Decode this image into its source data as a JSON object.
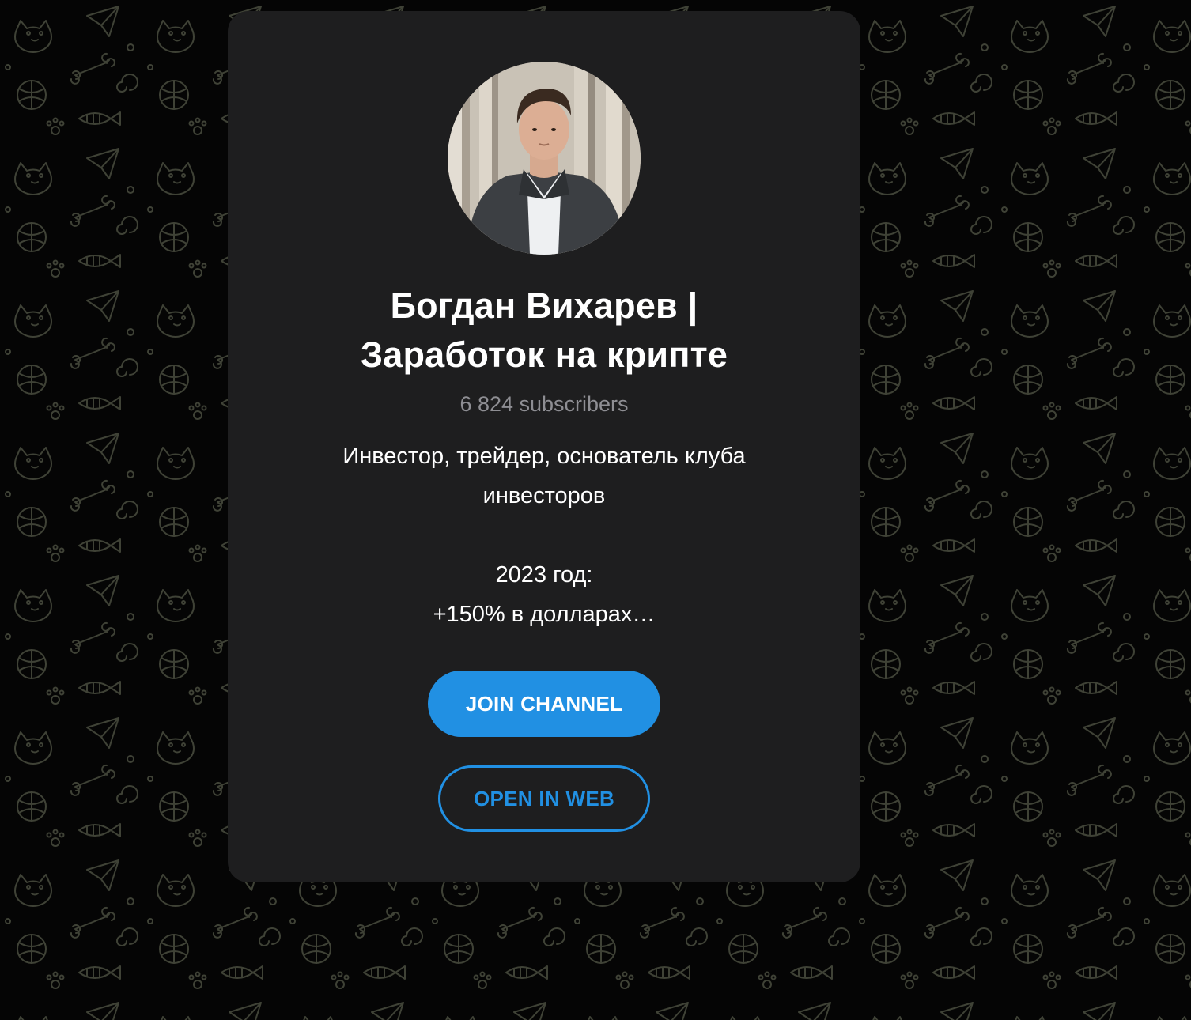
{
  "channel": {
    "title_lines": [
      "Богдан Вихарев |",
      "Заработок на крипте"
    ],
    "subscribers": "6 824 subscribers",
    "description_lines": [
      "Инвестор, трейдер, основатель клуба",
      "инвесторов",
      "",
      "2023 год:",
      "+150% в долларах…"
    ]
  },
  "actions": {
    "join_label": "JOIN CHANNEL",
    "web_label": "OPEN IN WEB"
  },
  "colors": {
    "accent": "#2190e3",
    "card": "#1e1e1f",
    "subtle_text": "#8e8e93",
    "background_pattern": "#3a3d33"
  }
}
